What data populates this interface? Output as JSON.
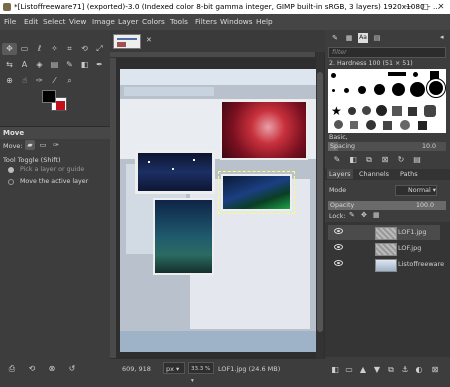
{
  "window": {
    "title": "*[Listoffreeware71] (exported)-3.0 (Indexed color 8-bit gamma integer, GIMP built-in sRGB, 3 layers) 1920x1080 – ...",
    "minimize": "—",
    "maximize": "□",
    "close": "✕"
  },
  "menu": [
    "File",
    "Edit",
    "Select",
    "View",
    "Image",
    "Layer",
    "Colors",
    "Tools",
    "Filters",
    "Windows",
    "Help"
  ],
  "tab": {
    "close": "✕"
  },
  "toolbox": {
    "tool_options_title": "Move",
    "move_label": "Move:",
    "tool_toggle_label": "Tool Toggle  (Shift)",
    "option_pick": "Pick a layer or guide",
    "option_move_active": "Move the active layer"
  },
  "brushes": {
    "filter_placeholder": "filter",
    "current_brush": "2. Hardness 100 (51 × 51)",
    "preset": "Basic,",
    "spacing_label": "Spacing",
    "spacing_value": "10.0"
  },
  "dock_tabs": [
    "Layers",
    "Channels",
    "Paths"
  ],
  "layers_panel": {
    "mode_label": "Mode",
    "mode_value": "Normal",
    "opacity_label": "Opacity",
    "opacity_value": "100.0",
    "lock_label": "Lock:",
    "layers": [
      {
        "name": "LOF1.jpg"
      },
      {
        "name": "LOF.jpg"
      },
      {
        "name": "Listoffreeware"
      }
    ]
  },
  "status": {
    "coords": "609, 918",
    "unit": "px",
    "zoom": "33.3 %",
    "file_info": "LOF1.jpg (24.6 MB)"
  },
  "colors": {
    "fg": "#000000",
    "bg": "#ffffff",
    "swatch_red": "#c4101a"
  }
}
